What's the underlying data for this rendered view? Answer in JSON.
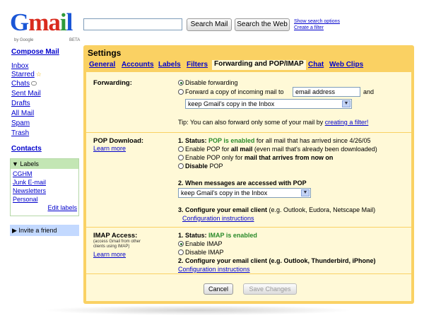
{
  "logo": {
    "letters": [
      "G",
      "m",
      "a",
      "i",
      "l"
    ],
    "by": "by Google",
    "beta": "BETA"
  },
  "search": {
    "value": "",
    "search_mail": "Search Mail",
    "search_web": "Search the Web",
    "options": "Show search options",
    "filter": "Create a filter"
  },
  "nav": {
    "compose": "Compose Mail",
    "items": [
      "Inbox",
      "Starred",
      "Chats",
      "Sent Mail",
      "Drafts",
      "All Mail",
      "Spam",
      "Trash"
    ],
    "contacts": "Contacts",
    "labels_header": "▼ Labels",
    "labels": [
      "CGHM",
      "Junk E-mail",
      "Newsletters",
      "Personal"
    ],
    "edit_labels": "Edit labels",
    "invite": "▶ Invite a friend"
  },
  "settings": {
    "title": "Settings",
    "tabs": [
      "General",
      "Accounts",
      "Labels",
      "Filters",
      "Forwarding and POP/IMAP",
      "Chat",
      "Web Clips"
    ],
    "active_tab": "Forwarding and POP/IMAP"
  },
  "forwarding": {
    "title": "Forwarding:",
    "disable": "Disable forwarding",
    "forward": "Forward a copy of incoming mail to",
    "address": "email address",
    "and": "and",
    "keep_select": "keep Gmail's copy in the Inbox",
    "tip": "Tip: You can also forward only some of your mail by",
    "tip_link": "creating a filter!"
  },
  "pop": {
    "title": "POP Download:",
    "learn": "Learn more",
    "status_prefix": "1. Status:",
    "status_value": "POP is enabled",
    "status_suffix": "for all mail that has arrived since 4/26/05",
    "opt1_a": "Enable POP for",
    "opt1_b": "all mail",
    "opt1_c": "(even mail that's already been downloaded)",
    "opt2_a": "Enable POP only for",
    "opt2_b": "mail that arrives from now on",
    "opt3": "Disable",
    "opt3_b": "POP",
    "when": "2. When messages are accessed with POP",
    "when_select": "keep Gmail's copy in the Inbox",
    "configure_a": "3. Configure your email client",
    "configure_b": "(e.g. Outlook, Eudora, Netscape Mail)",
    "configure_link": "Configuration instructions"
  },
  "imap": {
    "title": "IMAP Access:",
    "sub": "(access Gmail from other clients using IMAP)",
    "learn": "Learn more",
    "status_prefix": "1. Status:",
    "status_value": "IMAP is enabled",
    "enable": "Enable IMAP",
    "disable": "Disable IMAP",
    "configure": "2. Configure your email client (e.g. Outlook, Thunderbird, iPhone)",
    "configure_link": "Configuration instructions"
  },
  "actions": {
    "cancel": "Cancel",
    "save": "Save Changes"
  }
}
